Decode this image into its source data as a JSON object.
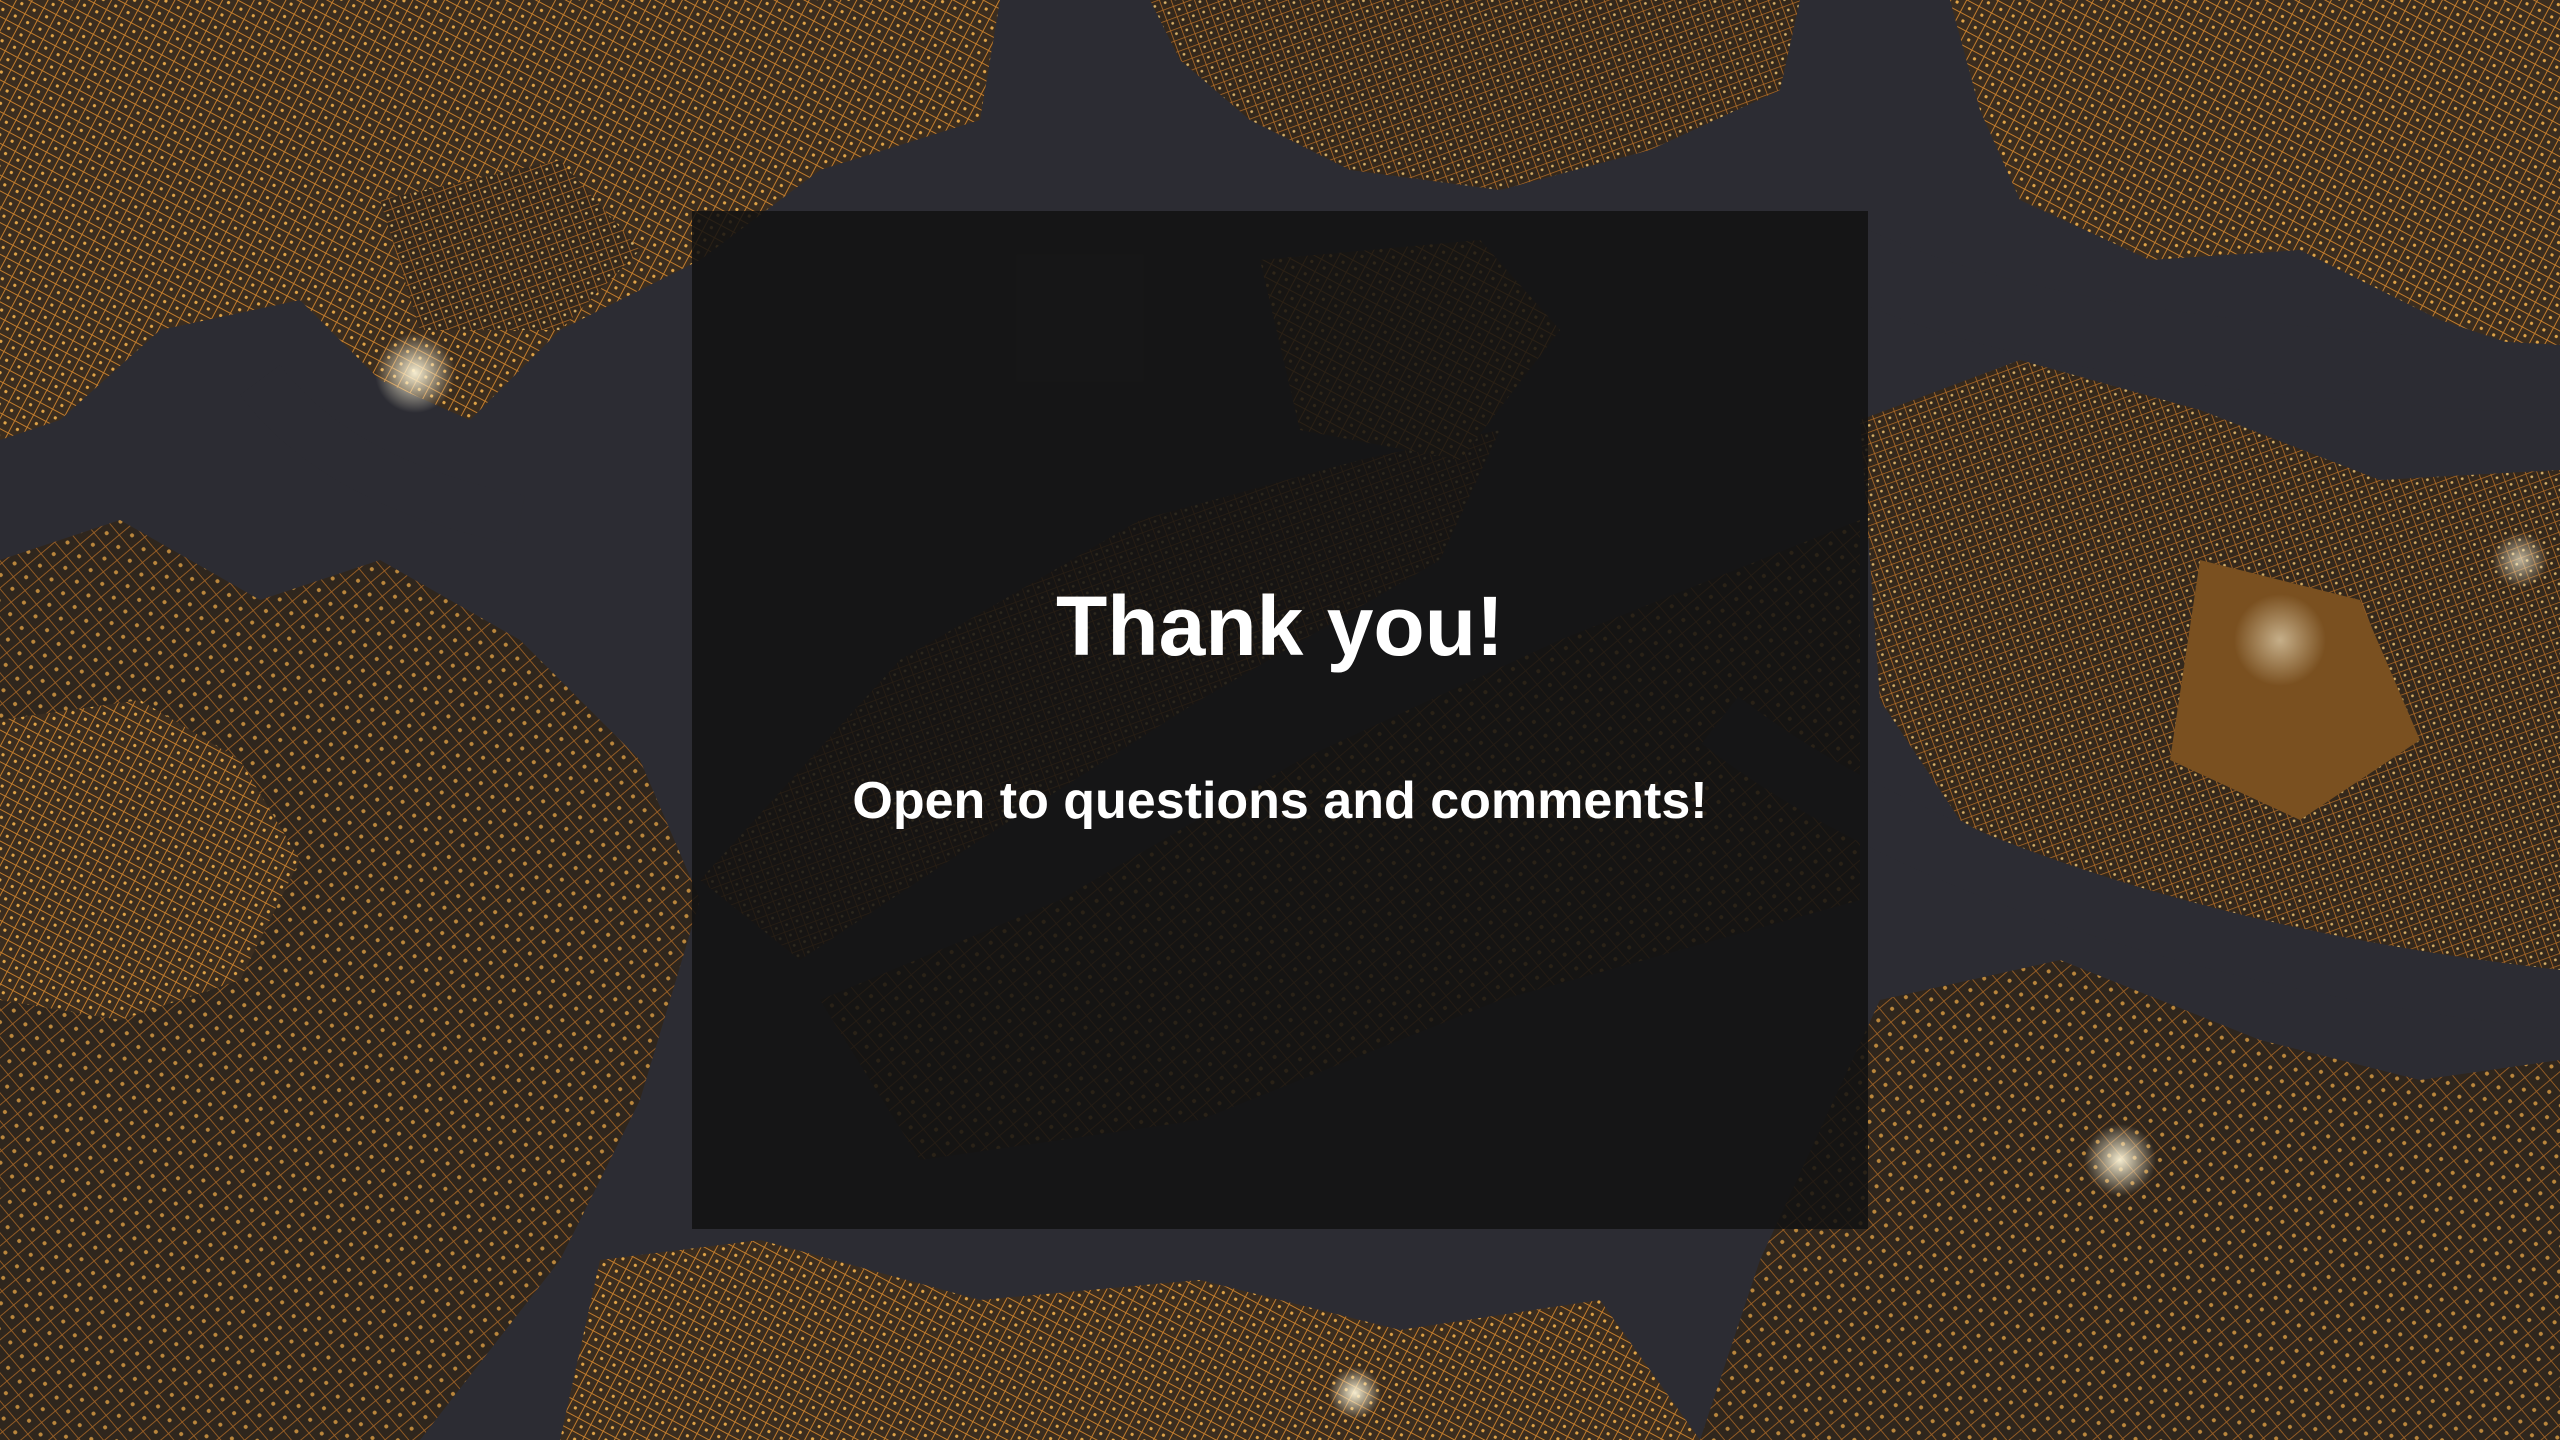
{
  "slide": {
    "title": "Thank you!",
    "subtitle": "Open to questions and comments!"
  },
  "background": {
    "description_icon": "city-night-satellite-map",
    "colors": {
      "water": "#2d2d35",
      "land": "#3a2e22",
      "lights": "#e89a3a",
      "bright_lights": "#fff3c8"
    }
  },
  "overlay": {
    "color": "#121212"
  }
}
